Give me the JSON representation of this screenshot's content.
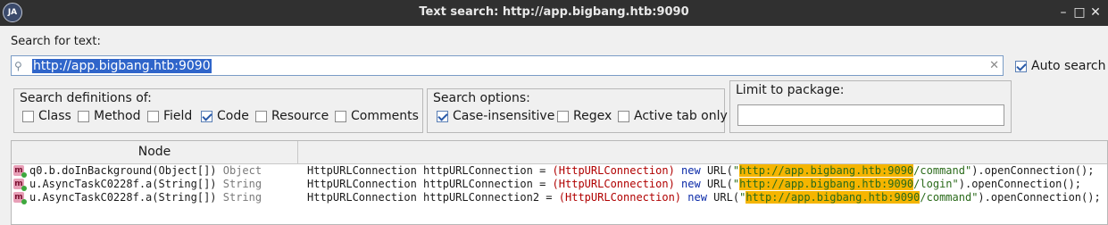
{
  "window": {
    "title": "Text search: http://app.bigbang.htb:9090",
    "app_icon": "jadx-logo-icon",
    "controls": [
      "minimize",
      "maximize",
      "close"
    ]
  },
  "search": {
    "label": "Search for text:",
    "value": "http://app.bigbang.htb:9090",
    "auto_search_label": "Auto search",
    "auto_search_checked": true
  },
  "definitions": {
    "title": "Search definitions of:",
    "options": [
      {
        "label": "Class",
        "checked": false
      },
      {
        "label": "Method",
        "checked": false
      },
      {
        "label": "Field",
        "checked": false
      },
      {
        "label": "Code",
        "checked": true
      },
      {
        "label": "Resource",
        "checked": false
      },
      {
        "label": "Comments",
        "checked": false
      }
    ]
  },
  "search_options": {
    "title": "Search options:",
    "options": [
      {
        "label": "Case-insensitive",
        "checked": true
      },
      {
        "label": "Regex",
        "checked": false
      },
      {
        "label": "Active tab only",
        "checked": false
      }
    ]
  },
  "limit": {
    "title": "Limit to package:",
    "value": ""
  },
  "results": {
    "columns": [
      "Node",
      ""
    ],
    "rows": [
      {
        "node": "q0.b.doInBackground(Object[])",
        "return_type": "Object",
        "code_pre": "HttpURLConnection httpURLConnection = ",
        "code_cast": "(HttpURLConnection) ",
        "code_new": "new",
        "code_url": " URL(",
        "code_match": "http://app.bigbang.htb:9090",
        "code_path": "/command\"",
        "code_post": ").openConnection();"
      },
      {
        "node": "u.AsyncTaskC0228f.a(String[])",
        "return_type": "String",
        "code_pre": "HttpURLConnection httpURLConnection = ",
        "code_cast": "(HttpURLConnection) ",
        "code_new": "new",
        "code_url": " URL(",
        "code_match": "http://app.bigbang.htb:9090",
        "code_path": "/login\"",
        "code_post": ").openConnection();"
      },
      {
        "node": "u.AsyncTaskC0228f.a(String[])",
        "return_type": "String",
        "code_pre": "HttpURLConnection httpURLConnection2 = ",
        "code_cast": "(HttpURLConnection) ",
        "code_new": "new",
        "code_url": " URL(",
        "code_match": "http://app.bigbang.htb:9090",
        "code_path": "/command\"",
        "code_post": ").openConnection();"
      }
    ]
  }
}
